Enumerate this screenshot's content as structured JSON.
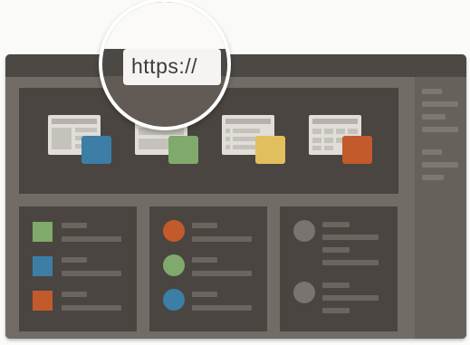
{
  "address_bar": {
    "url": "https://"
  },
  "colors": {
    "blue": "#3c7ea6",
    "green": "#80aa6b",
    "yellow": "#e2bf5e",
    "orange": "#c35a2c"
  },
  "icons": [
    "browser-window-icon",
    "layout-template-icon",
    "list-template-icon",
    "grid-template-icon"
  ]
}
